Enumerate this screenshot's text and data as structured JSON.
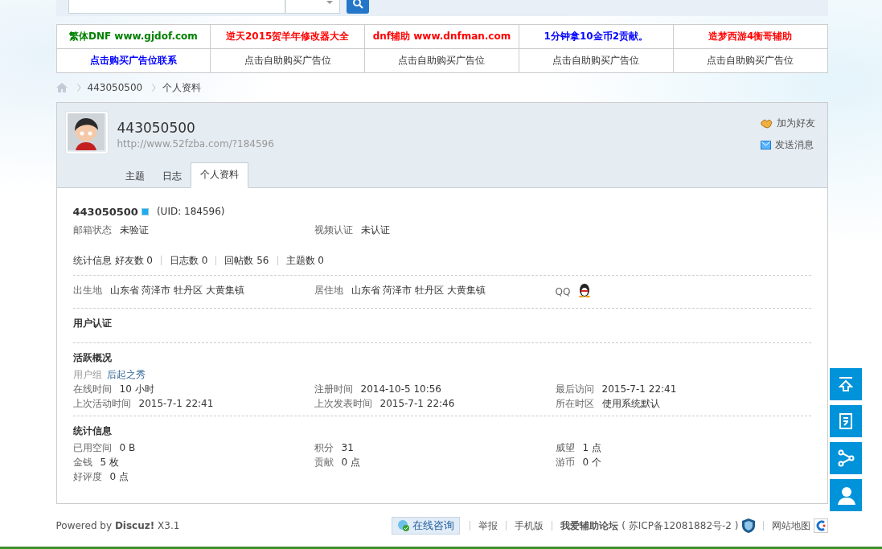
{
  "ads": [
    [
      {
        "text": "繁体DNF www.gjdof.com",
        "color": "#008000"
      },
      {
        "text": "逆天2015贺羊年修改器大全",
        "color": "#ff0000"
      },
      {
        "text": "dnf辅助 www.dnfman.com",
        "color": "#ff0000"
      },
      {
        "text": "1分钟拿10金币2贡献。",
        "color": "#0000ff"
      },
      {
        "text": "造梦西游4衡哥辅助",
        "color": "#ff0000"
      }
    ],
    [
      {
        "text": "点击购买广告位联系",
        "color": "#0000ff"
      },
      {
        "text": "点击自助购买广告位"
      },
      {
        "text": "点击自助购买广告位"
      },
      {
        "text": "点击自助购买广告位"
      },
      {
        "text": "点击自助购买广告位"
      }
    ]
  ],
  "breadcrumb": [
    "443050500",
    "个人资料"
  ],
  "profile": {
    "username": "443050500",
    "url": "http://www.52fzba.com/?184596",
    "actions": [
      {
        "kind": "friend",
        "label": "加为好友"
      },
      {
        "kind": "message",
        "label": "发送消息"
      }
    ],
    "tabs": [
      {
        "label": "主题",
        "selected": false
      },
      {
        "label": "日志",
        "selected": false
      },
      {
        "label": "个人资料",
        "selected": true
      }
    ]
  },
  "details": {
    "name": "443050500",
    "uid": "(UID: 184596)",
    "verification": [
      {
        "label": "邮箱状态",
        "value": "未验证"
      },
      {
        "label": "视频认证",
        "value": "未认证"
      }
    ],
    "stats_label": "统计信息",
    "stats": [
      "好友数 0",
      "日志数 0",
      "回帖数 56",
      "主题数 0"
    ],
    "places": [
      {
        "label": "出生地",
        "value": "山东省 菏泽市 牡丹区 大黄集镇"
      },
      {
        "label": "居住地",
        "value": "山东省 菏泽市 牡丹区 大黄集镇"
      }
    ],
    "qq_label": "QQ",
    "verify_heading": "用户认证",
    "activity_heading": "活跃概况",
    "group_label": "用户组",
    "group": "后起之秀",
    "activity": [
      {
        "label": "在线时间",
        "value": "10 小时"
      },
      {
        "label": "注册时间",
        "value": "2014-10-5 10:56"
      },
      {
        "label": "最后访问",
        "value": "2015-7-1 22:41"
      },
      {
        "label": "上次活动时间",
        "value": "2015-7-1 22:41"
      },
      {
        "label": "上次发表时间",
        "value": "2015-7-1 22:46"
      },
      {
        "label": "所在时区",
        "value": "使用系统默认"
      }
    ],
    "counts_heading": "统计信息",
    "counts": [
      {
        "label": "已用空间",
        "value": "0 B"
      },
      {
        "label": "积分",
        "value": "31"
      },
      {
        "label": "威望",
        "value": "1 点"
      },
      {
        "label": "金钱",
        "value": "5 枚"
      },
      {
        "label": "贡献",
        "value": "0 点"
      },
      {
        "label": "游币",
        "value": "0 个"
      },
      {
        "label": "好评度",
        "value": "0 点"
      }
    ]
  },
  "footer": {
    "powered": "Powered by **Discuz!** X3.1",
    "consult": "在线咨询",
    "links": [
      "举报",
      "手机版"
    ],
    "site": "**我爱辅助论坛** ( 苏ICP备12081882号-2 )",
    "sitemap": "网站地图"
  }
}
